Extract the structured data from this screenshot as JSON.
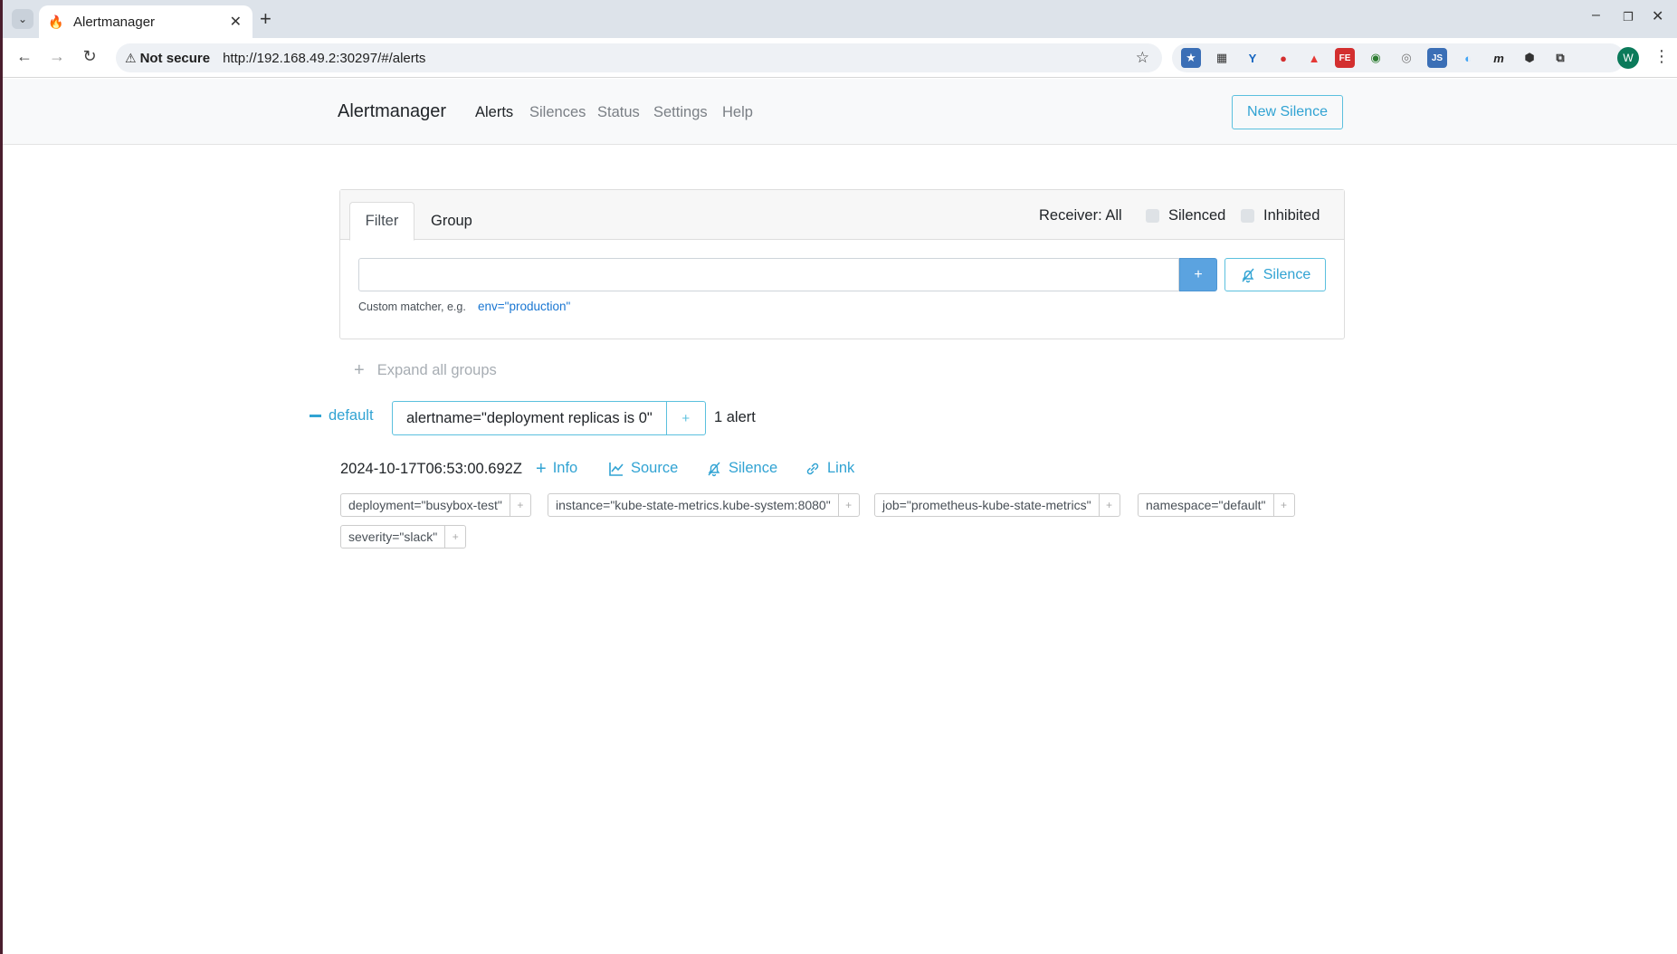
{
  "browser": {
    "tab_title": "Alertmanager",
    "security_label": "Not secure",
    "url": "http://192.168.49.2:30297/#/alerts",
    "avatar_letter": "W"
  },
  "navbar": {
    "brand": "Alertmanager",
    "links": [
      "Alerts",
      "Silences",
      "Status",
      "Settings",
      "Help"
    ],
    "active": "Alerts",
    "new_silence": "New Silence"
  },
  "filter": {
    "tab_filter": "Filter",
    "tab_group": "Group",
    "receiver": "Receiver: All",
    "silenced_label": "Silenced",
    "inhibited_label": "Inhibited",
    "input_value": "",
    "add_button": "+",
    "silence_button": "Silence",
    "hint_text": "Custom matcher, e.g.",
    "hint_example": "env=\"production\""
  },
  "expand_all": "Expand all groups",
  "group": {
    "receiver": "default",
    "label": "alertname=\"deployment replicas is 0\"",
    "add": "+",
    "count": "1 alert"
  },
  "alert": {
    "timestamp": "2024-10-17T06:53:00.692Z",
    "actions": {
      "info": "Info",
      "source": "Source",
      "silence": "Silence",
      "link": "Link"
    },
    "labels": [
      "deployment=\"busybox-test\"",
      "instance=\"kube-state-metrics.kube-system:8080\"",
      "job=\"prometheus-kube-state-metrics\"",
      "namespace=\"default\"",
      "severity=\"slack\""
    ],
    "label_add": "+"
  },
  "colors": {
    "accent": "#31a3d3",
    "primary_button": "#5ba3e0",
    "navbar_bg": "#f8f9fa"
  }
}
